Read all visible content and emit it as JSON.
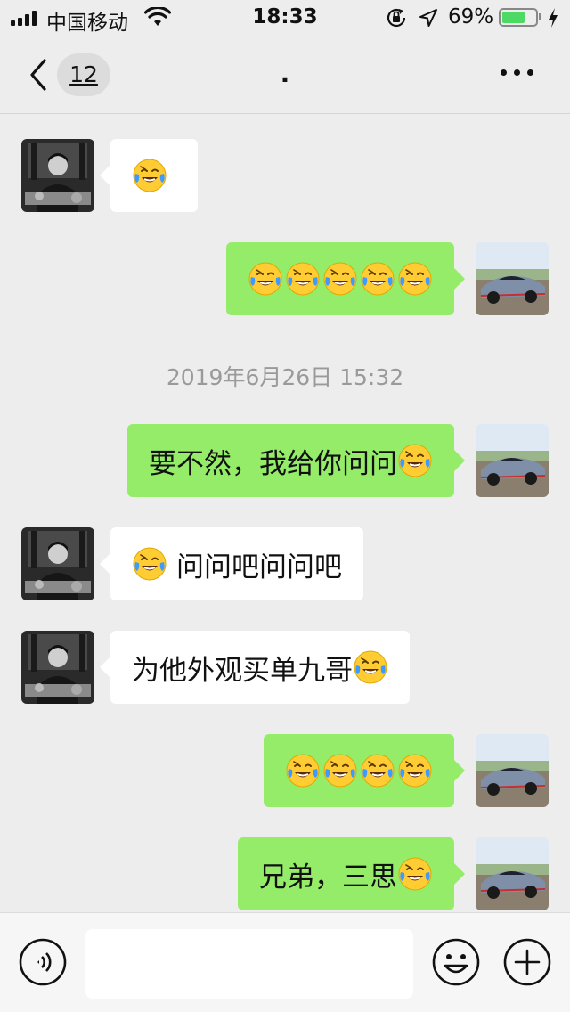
{
  "status_bar": {
    "carrier": "中国移动",
    "time": "18:33",
    "battery_percent": "69%",
    "battery_level": 0.69,
    "battery_color": "#4cd964",
    "icons": [
      "signal-icon",
      "wifi-icon",
      "orientation-lock-icon",
      "location-arrow-icon",
      "battery-icon",
      "charging-bolt-icon"
    ]
  },
  "nav": {
    "unread_count": "12",
    "title": ".",
    "icons": [
      "chevron-left-icon",
      "more-dots-icon"
    ]
  },
  "chat": {
    "bubble_colors": {
      "incoming": "#ffffff",
      "outgoing": "#95ec69"
    },
    "messages": [
      {
        "side": "left",
        "text": "",
        "emoji_after": 0,
        "emoji_before": 1
      },
      {
        "side": "right",
        "text": "",
        "emoji_after": 5,
        "emoji_before": 0
      },
      {
        "side": "right",
        "text": "要不然，我给你问问",
        "emoji_after": 1,
        "emoji_before": 0
      },
      {
        "side": "left",
        "text": "问问吧问问吧",
        "emoji_after": 0,
        "emoji_before": 1
      },
      {
        "side": "left",
        "text": "为他外观买单九哥",
        "emoji_after": 1,
        "emoji_before": 0
      },
      {
        "side": "right",
        "text": "",
        "emoji_after": 4,
        "emoji_before": 0
      },
      {
        "side": "right",
        "text": "兄弟，三思",
        "emoji_after": 1,
        "emoji_before": 0
      }
    ],
    "timestamp": "2019年6月26日 15:32",
    "emoji_name": "tears-of-joy-emoji",
    "avatars": {
      "left": "portrait-avatar",
      "right": "sports-car-avatar"
    }
  },
  "input_bar": {
    "placeholder": "",
    "icons": [
      "voice-icon",
      "emoji-icon",
      "plus-icon"
    ]
  }
}
